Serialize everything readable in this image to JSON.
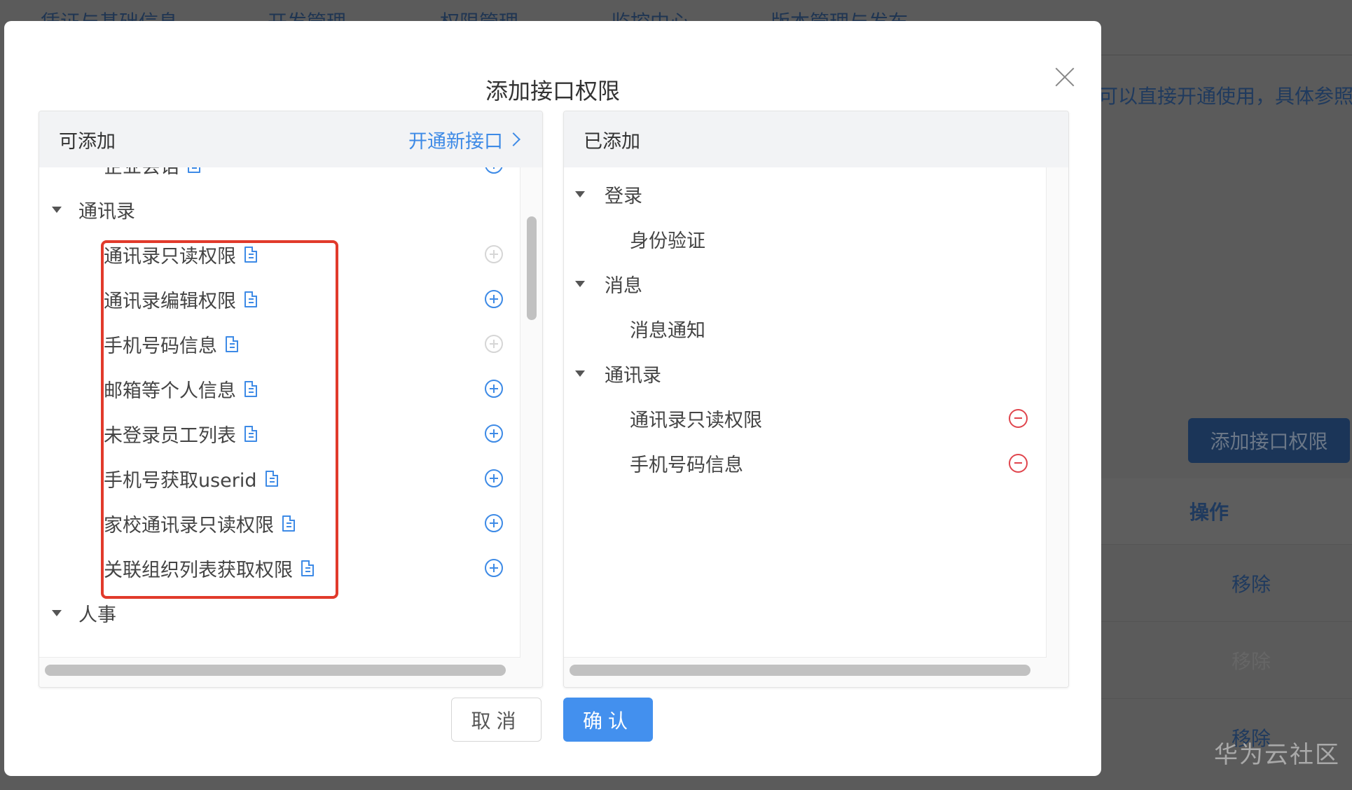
{
  "background": {
    "tabs": [
      "凭证与基础信息",
      "开发管理",
      "权限管理",
      "监控中心",
      "版本管理与发布"
    ],
    "notice_fragment": "可以直接开通使用，具体参照",
    "add_button": "添加接口权限",
    "table": {
      "header": "操作",
      "rows": [
        "移除",
        "移除",
        "移除"
      ]
    },
    "watermark": "华为云社区"
  },
  "modal": {
    "title": "添加接口权限",
    "close_icon": "close-icon",
    "left_panel": {
      "title": "可添加",
      "link_label": "开通新接口",
      "link_icon": "chevron-right-icon",
      "items": [
        {
          "type": "leaf",
          "label": "企业会话",
          "added": false,
          "partial": true
        },
        {
          "type": "group",
          "label": "通讯录",
          "expanded": true
        },
        {
          "type": "leaf",
          "label": "通讯录只读权限",
          "added": true
        },
        {
          "type": "leaf",
          "label": "通讯录编辑权限",
          "added": false
        },
        {
          "type": "leaf",
          "label": "手机号码信息",
          "added": true
        },
        {
          "type": "leaf",
          "label": "邮箱等个人信息",
          "added": false
        },
        {
          "type": "leaf",
          "label": "未登录员工列表",
          "added": false
        },
        {
          "type": "leaf",
          "label": "手机号获取userid",
          "added": false
        },
        {
          "type": "leaf",
          "label": "家校通讯录只读权限",
          "added": false
        },
        {
          "type": "leaf",
          "label": "关联组织列表获取权限",
          "added": false
        },
        {
          "type": "group",
          "label": "人事",
          "expanded": true
        }
      ],
      "highlight_color": "#e13a2b"
    },
    "right_panel": {
      "title": "已添加",
      "items": [
        {
          "type": "group",
          "label": "登录"
        },
        {
          "type": "leaf",
          "label": "身份验证",
          "removable": false
        },
        {
          "type": "group",
          "label": "消息"
        },
        {
          "type": "leaf",
          "label": "消息通知",
          "removable": false
        },
        {
          "type": "group",
          "label": "通讯录"
        },
        {
          "type": "leaf",
          "label": "通讯录只读权限",
          "removable": true
        },
        {
          "type": "leaf",
          "label": "手机号码信息",
          "removable": true
        }
      ]
    },
    "footer": {
      "cancel_label": "取消",
      "confirm_label": "确认"
    }
  },
  "colors": {
    "accent": "#4390ee",
    "link": "#3d8ae6",
    "danger": "#e0454d",
    "overlay": "#5b5b5b"
  }
}
